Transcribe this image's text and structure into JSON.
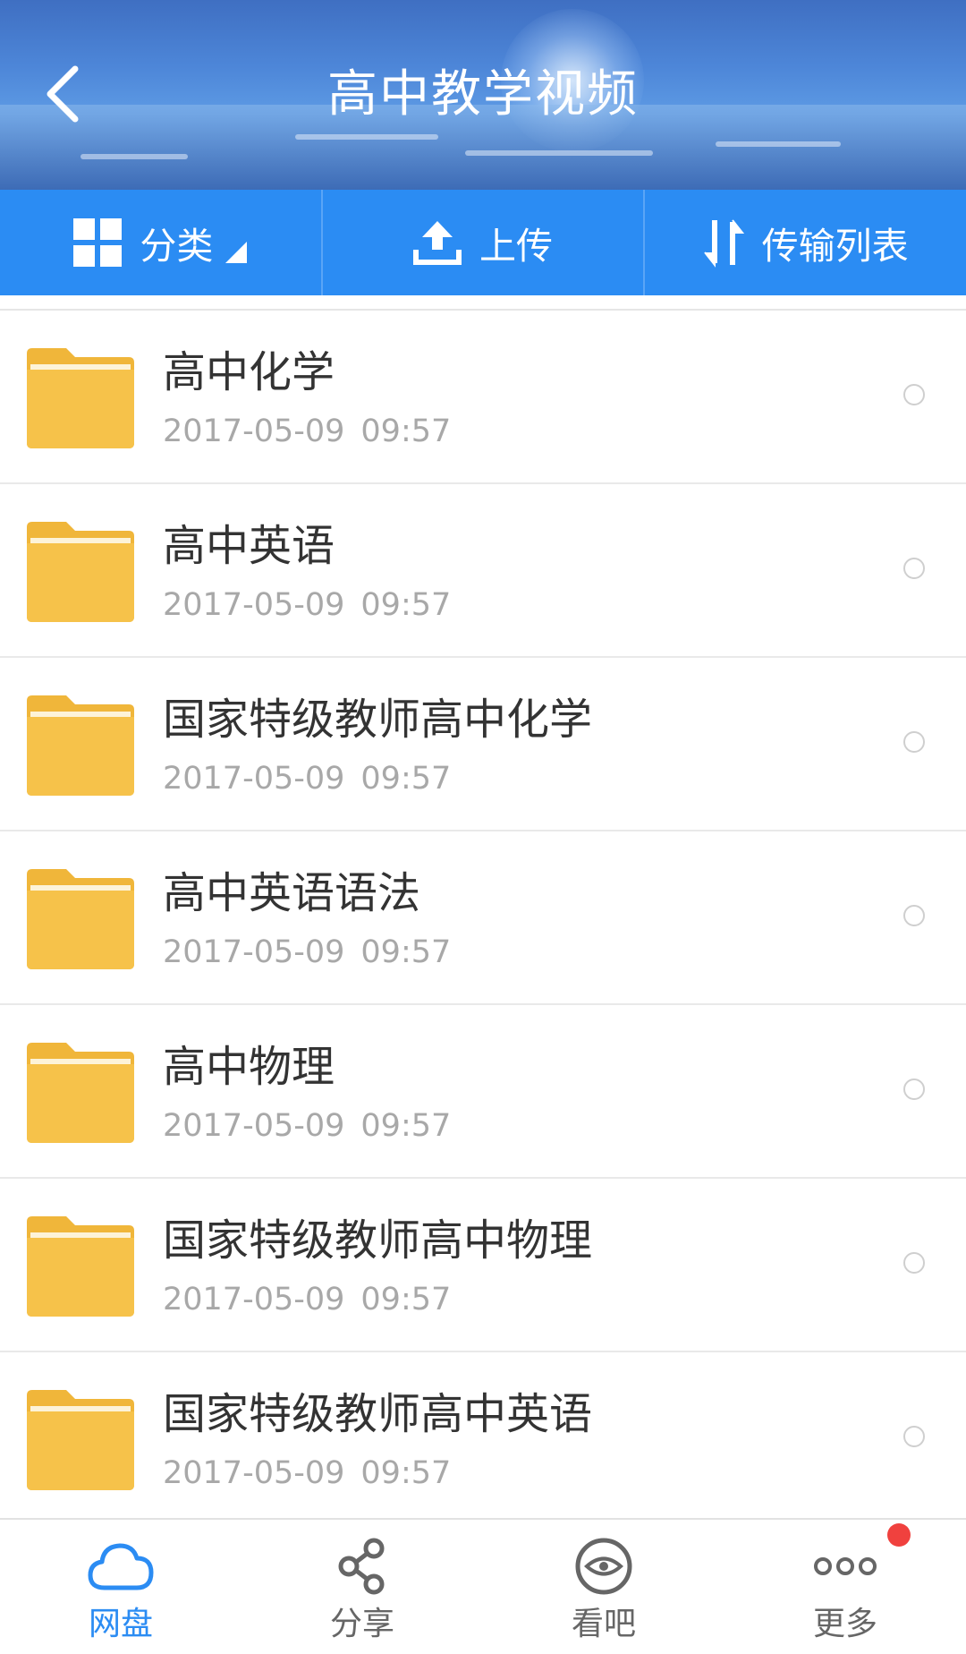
{
  "header": {
    "title": "高中教学视频",
    "back_icon": "chevron-left-icon"
  },
  "toolbar": {
    "category": {
      "label": "分类",
      "icon": "grid-icon"
    },
    "upload": {
      "label": "上传",
      "icon": "upload-icon"
    },
    "transfer": {
      "label": "传输列表",
      "icon": "transfer-arrows-icon"
    }
  },
  "files": [
    {
      "name": "高中化学",
      "date": "2017-05-09",
      "time": "09:57"
    },
    {
      "name": "高中英语",
      "date": "2017-05-09",
      "time": "09:57"
    },
    {
      "name": "国家特级教师高中化学",
      "date": "2017-05-09",
      "time": "09:57"
    },
    {
      "name": "高中英语语法",
      "date": "2017-05-09",
      "time": "09:57"
    },
    {
      "name": "高中物理",
      "date": "2017-05-09",
      "time": "09:57"
    },
    {
      "name": "国家特级教师高中物理",
      "date": "2017-05-09",
      "time": "09:57"
    },
    {
      "name": "国家特级教师高中英语",
      "date": "2017-05-09",
      "time": "09:57"
    }
  ],
  "bottom_nav": [
    {
      "label": "网盘",
      "icon": "cloud-icon",
      "active": true
    },
    {
      "label": "分享",
      "icon": "share-icon",
      "active": false
    },
    {
      "label": "看吧",
      "icon": "eye-icon",
      "active": false
    },
    {
      "label": "更多",
      "icon": "more-dots-icon",
      "active": false,
      "badge": true
    }
  ],
  "colors": {
    "accent": "#2b8cf3",
    "folder": "#f6c24a",
    "folder_tab": "#f0b63a",
    "badge": "#f0413e",
    "nav_inactive": "#666666"
  }
}
